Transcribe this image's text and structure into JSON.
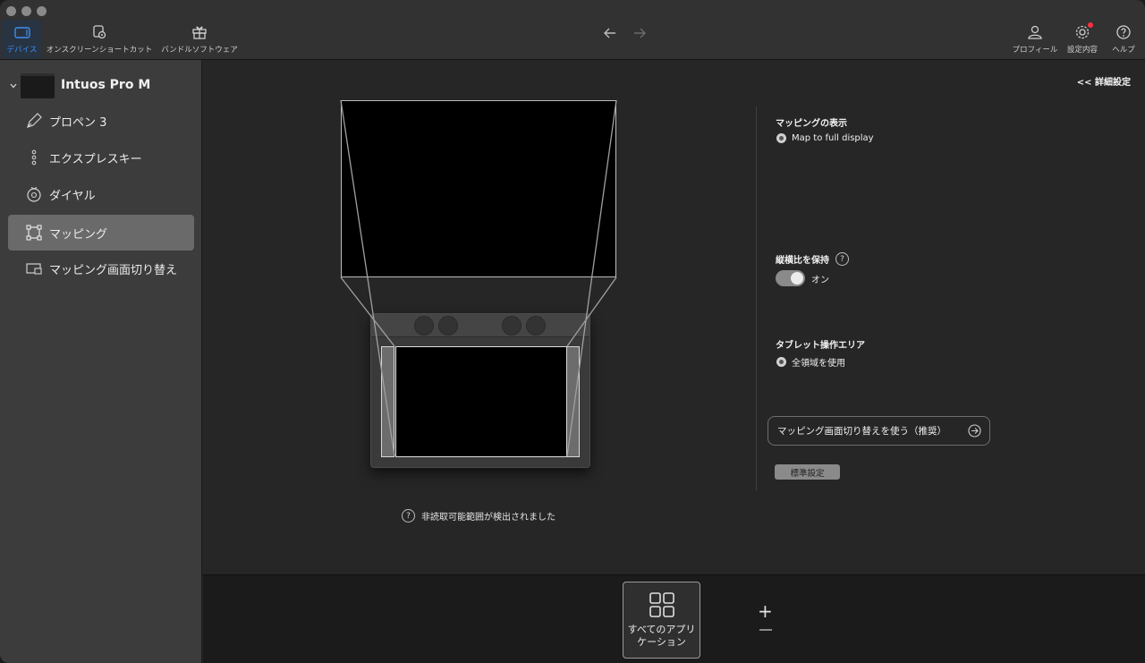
{
  "toolbar": {
    "items": [
      {
        "label": "デバイス",
        "icon": "tablet-icon"
      },
      {
        "label": "オンスクリーンショートカット",
        "icon": "onscreen-shortcut-icon"
      },
      {
        "label": "バンドルソフトウェア",
        "icon": "gift-icon"
      }
    ],
    "right_items": [
      {
        "label": "プロフィール",
        "icon": "person-icon"
      },
      {
        "label": "設定内容",
        "icon": "gear-icon"
      },
      {
        "label": "ヘルプ",
        "icon": "help-icon"
      }
    ],
    "accent_color": "#3d8ef0",
    "badge_color": "#ff3040"
  },
  "sidebar": {
    "device_name": "Intuos Pro M",
    "items": [
      {
        "label": "プロペン 3",
        "icon": "pen-icon"
      },
      {
        "label": "エクスプレスキー",
        "icon": "express-keys-icon"
      },
      {
        "label": "ダイヤル",
        "icon": "dial-icon"
      },
      {
        "label": "マッピング",
        "icon": "mapping-icon",
        "selected": true
      },
      {
        "label": "マッピング画面切り替え",
        "icon": "display-toggle-icon"
      }
    ]
  },
  "main": {
    "advanced_link": "<< 詳細設定",
    "notice": "非読取可能範囲が検出されました",
    "mapping_display": {
      "title": "マッピングの表示",
      "option": "Map to full display"
    },
    "aspect": {
      "title": "縦横比を保持",
      "toggle_label": "オン"
    },
    "tablet_area": {
      "title": "タブレット操作エリア",
      "option": "全領域を使用"
    },
    "switch_button": "マッピング画面切り替えを使う（推奨）",
    "default_button": "標準設定"
  },
  "bottom": {
    "app_tile_label": "すべてのアプリケーション",
    "plus": "+"
  }
}
